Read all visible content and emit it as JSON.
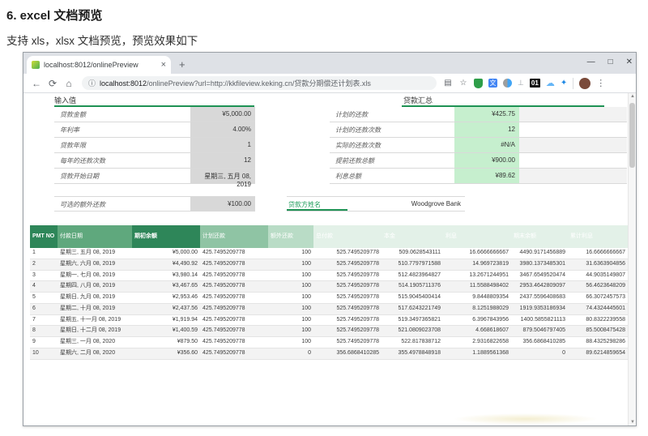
{
  "doc": {
    "heading": "6. excel 文档预览",
    "subtitle": "支持 xls，xlsx 文档预览，预览效果如下"
  },
  "browser": {
    "tab_title": "localhost:8012/onlinePreview",
    "tab_close": "×",
    "new_tab": "+",
    "controls": {
      "minimize": "—",
      "maximize": "□",
      "close": "✕"
    },
    "nav": {
      "back": "←",
      "reload": "⟳",
      "home": "⌂"
    },
    "omnibox": {
      "info": "ⓘ",
      "url_host": "localhost:8012",
      "url_rest": "/onlinePreview?url=http://kkfileview.keking.cn/贷款分期偿还计划表.xls"
    },
    "extension_badge": "01",
    "menu_dots": "⋮"
  },
  "sheet": {
    "inputs": {
      "title": "输入值",
      "rows": [
        {
          "label": "贷款金额",
          "value": "¥5,000.00"
        },
        {
          "label": "年利率",
          "value": "4.00%"
        },
        {
          "label": "贷款年限",
          "value": "1"
        },
        {
          "label": "每年的还款次数",
          "value": "12"
        },
        {
          "label": "贷款开始日期",
          "value": "星期三, 五月 08, 2019"
        }
      ],
      "extra": {
        "label": "可选的额外还款",
        "value": "¥100.00"
      }
    },
    "summary": {
      "title": "贷款汇总",
      "rows": [
        {
          "label": "计划的还款",
          "value": "¥425.75"
        },
        {
          "label": "计划的还款次数",
          "value": "12"
        },
        {
          "label": "实际的还款次数",
          "value": "#N/A"
        },
        {
          "label": "提前还款总额",
          "value": "¥900.00"
        },
        {
          "label": "利息总额",
          "value": "¥89.62"
        }
      ],
      "lender": {
        "label": "贷款方姓名",
        "value": "Woodgrove Bank"
      }
    },
    "table": {
      "headers": [
        "PMT NO",
        "付款日期",
        "期初余额",
        "计划还款",
        "额外还款",
        "总付款",
        "本金",
        "利息",
        "期末余额",
        "累计利息"
      ],
      "rows": [
        [
          "1",
          "星期三, 五月 08, 2019",
          "¥5,000.00",
          "425.7495209778",
          "100",
          "525.7495209778",
          "509.0628543111",
          "16.6666666667",
          "4490.9171456889",
          "16.6666666667"
        ],
        [
          "2",
          "星期六, 六月 08, 2019",
          "¥4,490.92",
          "425.7495209778",
          "100",
          "525.7495209778",
          "510.7797971588",
          "14.969723819",
          "3980.1373485301",
          "31.6363904856"
        ],
        [
          "3",
          "星期一, 七月 08, 2019",
          "¥3,980.14",
          "425.7495209778",
          "100",
          "525.7495209778",
          "512.4823964827",
          "13.2671244951",
          "3467.6549520474",
          "44.9035149807"
        ],
        [
          "4",
          "星期四, 八月 08, 2019",
          "¥3,467.65",
          "425.7495209778",
          "100",
          "525.7495209778",
          "514.1905711376",
          "11.5588498402",
          "2953.4642809097",
          "56.4623648209"
        ],
        [
          "5",
          "星期日, 九月 08, 2019",
          "¥2,953.46",
          "425.7495209778",
          "100",
          "525.7495209778",
          "515.9045400414",
          "9.8448809354",
          "2437.5596408683",
          "66.3072457573"
        ],
        [
          "6",
          "星期二, 十月 08, 2019",
          "¥2,437.56",
          "425.7495209778",
          "100",
          "525.7495209778",
          "517.6243221749",
          "8.1251988029",
          "1919.9353186934",
          "74.4324445601"
        ],
        [
          "7",
          "星期五, 十一月 08, 2019",
          "¥1,919.94",
          "425.7495209778",
          "100",
          "525.7495209778",
          "519.3497365821",
          "6.3967843956",
          "1400.5855821113",
          "80.8322239558"
        ],
        [
          "8",
          "星期日, 十二月 08, 2019",
          "¥1,400.59",
          "425.7495209778",
          "100",
          "525.7495209778",
          "521.0809023708",
          "4.668618607",
          "879.5046797405",
          "85.5008475428"
        ],
        [
          "9",
          "星期三, 一月 08, 2020",
          "¥879.50",
          "425.7495209778",
          "100",
          "525.7495209778",
          "522.817838712",
          "2.9316822658",
          "356.6868410285",
          "88.4325298286"
        ],
        [
          "10",
          "星期六, 二月 08, 2020",
          "¥356.60",
          "425.7495209778",
          "0",
          "356.6868410285",
          "355.4978848918",
          "1.1889561368",
          "0",
          "89.6214859654"
        ]
      ]
    }
  },
  "colors": {
    "accent_green": "#1e9254",
    "cell_green": "#c6efce",
    "cell_gray": "#d8d8d8",
    "header_dark_green": "#2e8659"
  }
}
